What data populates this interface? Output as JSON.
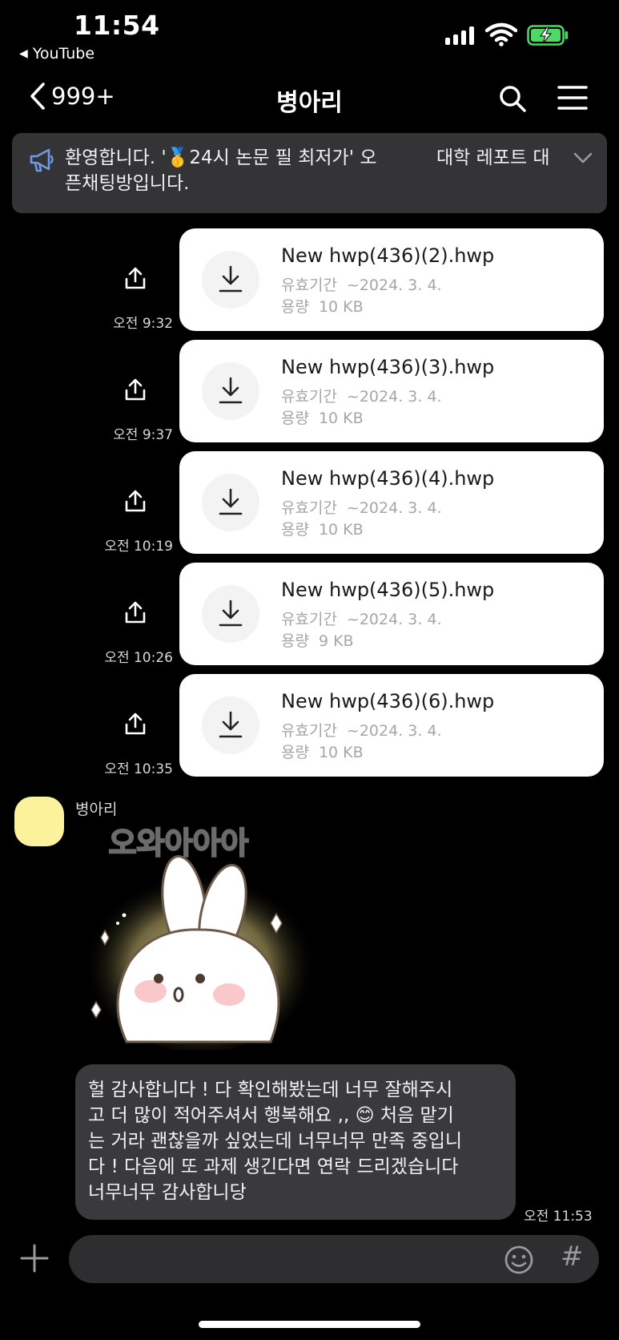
{
  "status_bar": {
    "time": "11:54",
    "back_app": "YouTube",
    "back_app_icon": "back-triangle-icon",
    "battery_color": "#4cd964"
  },
  "nav": {
    "back_count": "999+",
    "title": "병아리",
    "icons": [
      "chevron-left-icon",
      "search-icon",
      "menu-icon"
    ]
  },
  "notice": {
    "icon": "megaphone-icon",
    "text": "환영합니다. '🥇24시 논문 필 최저가' 오픈채팅방입니다.",
    "right_text": "대학 레포트 대",
    "expand_icon": "chevron-down-icon"
  },
  "files": [
    {
      "name": "New hwp(436)(2).hwp",
      "expiry_label": "유효기간",
      "expiry": "~2024. 3. 4.",
      "size_label": "용량",
      "size": "10 KB",
      "time": "오전 9:32"
    },
    {
      "name": "New hwp(436)(3).hwp",
      "expiry_label": "유효기간",
      "expiry": "~2024. 3. 4.",
      "size_label": "용량",
      "size": "10 KB",
      "time": "오전 9:37"
    },
    {
      "name": "New hwp(436)(4).hwp",
      "expiry_label": "유효기간",
      "expiry": "~2024. 3. 4.",
      "size_label": "용량",
      "size": "10 KB",
      "time": "오전 10:19"
    },
    {
      "name": "New hwp(436)(5).hwp",
      "expiry_label": "유효기간",
      "expiry": "~2024. 3. 4.",
      "size_label": "용량",
      "size": "9 KB",
      "time": "오전 10:26"
    },
    {
      "name": "New hwp(436)(6).hwp",
      "expiry_label": "유효기간",
      "expiry": "~2024. 3. 4.",
      "size_label": "용량",
      "size": "10 KB",
      "time": "오전 10:35"
    }
  ],
  "incoming": {
    "sender": "병아리",
    "avatar_color": "#fdf29c",
    "sticker_text": "오와아아아",
    "message": "헐 감사합니다 ! 다 확인해봤는데 너무 잘해주시\n고 더 많이 적어주셔서 행복해요 ,, 😊 처음 맡기\n는 거라 괜찮을까 싶었는데 너무너무 만족 중입니\n다 ! 다음에 또 과제 생긴다면 연락 드리겠습니다\n너무너무 감사합니당",
    "time": "오전 11:53"
  },
  "input_bar": {
    "placeholder": "",
    "icons": [
      "plus-icon",
      "emoji-icon",
      "hash-icon"
    ],
    "hash": "#"
  }
}
